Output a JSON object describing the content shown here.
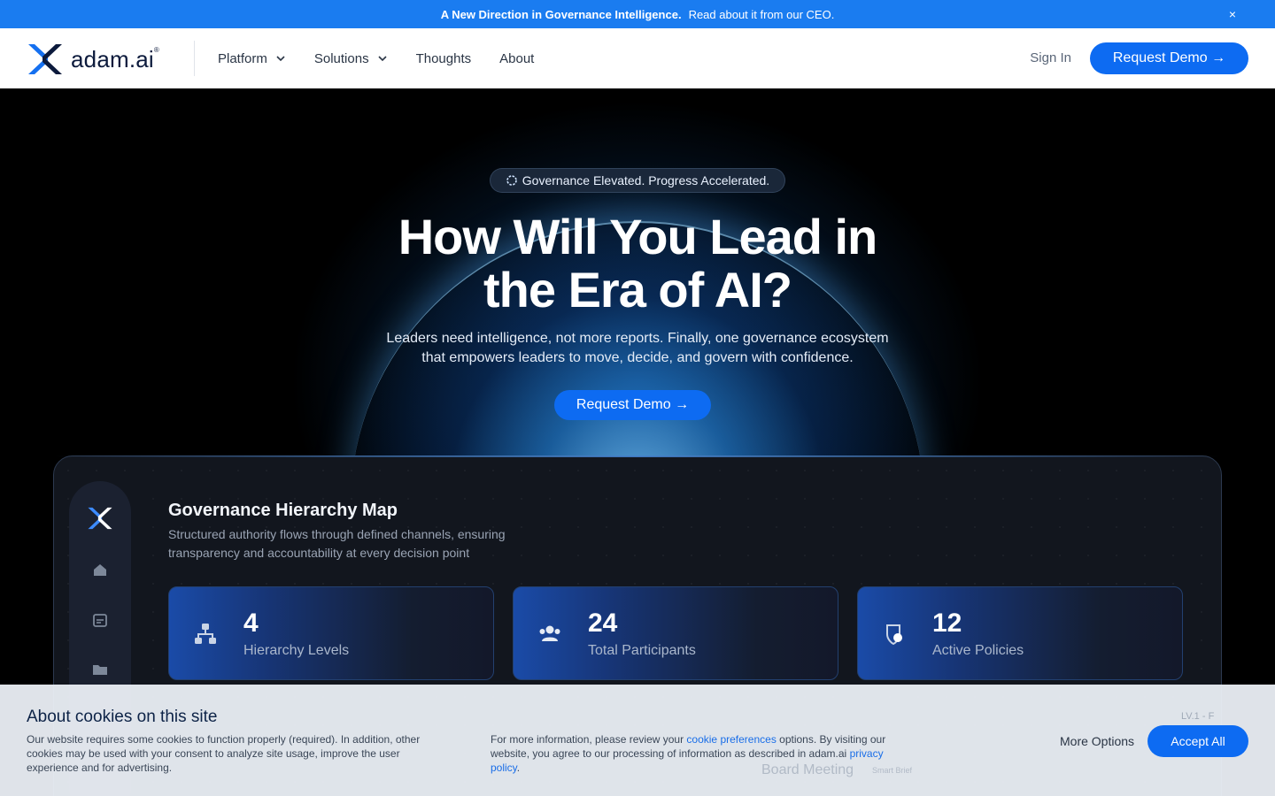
{
  "announcement": {
    "bold": "A New Direction in Governance Intelligence.",
    "text": "Read about it from our CEO.",
    "close": "×"
  },
  "nav": {
    "logo_text": "adam.ai",
    "logo_tm": "®",
    "links": [
      {
        "label": "Platform",
        "has_dropdown": true
      },
      {
        "label": "Solutions",
        "has_dropdown": true
      },
      {
        "label": "Thoughts",
        "has_dropdown": false
      },
      {
        "label": "About",
        "has_dropdown": false
      }
    ],
    "sign_in": "Sign In",
    "cta": "Request Demo",
    "cta_arrow": "→"
  },
  "hero": {
    "pill": "Governance Elevated. Progress Accelerated.",
    "title_line1": "How Will You Lead in",
    "title_line2": "the Era of AI?",
    "subtitle_line1": "Leaders need intelligence, not more reports. Finally, one governance ecosystem",
    "subtitle_line2": "that empowers leaders to move, decide, and govern with confidence.",
    "cta": "Request Demo",
    "cta_arrow": "→"
  },
  "dashboard": {
    "title": "Governance Hierarchy Map",
    "description": "Structured authority flows through defined channels, ensuring transparency and accountability at every decision point",
    "stats": [
      {
        "value": "4",
        "label": "Hierarchy Levels",
        "icon": "hierarchy-icon"
      },
      {
        "value": "24",
        "label": "Total Participants",
        "icon": "users-icon"
      },
      {
        "value": "12",
        "label": "Active Policies",
        "icon": "policy-shield-icon"
      }
    ],
    "rail_icons": [
      "home-icon",
      "calendar-icon",
      "folder-icon"
    ],
    "faded_labels": {
      "level": "LV.1 - F",
      "meeting": "Board Meeting",
      "badge": "Smart Brief"
    }
  },
  "cookie": {
    "title": "About cookies on this site",
    "text1": "Our website requires some cookies to function properly (required). In addition, other cookies may be used with your consent to analyze site usage, improve the user experience and for advertising.",
    "text2_a": "For more information, please review your ",
    "link1": "cookie preferences",
    "text2_b": " options. By visiting our website, you agree to our processing of information as described in adam.ai ",
    "link2": "privacy policy",
    "text2_c": ".",
    "more_options": "More Options",
    "accept_all": "Accept All"
  },
  "colors": {
    "brand_blue": "#0d6bf2",
    "announce_blue": "#1a7cf0",
    "logo_navy": "#0c1a3c"
  }
}
